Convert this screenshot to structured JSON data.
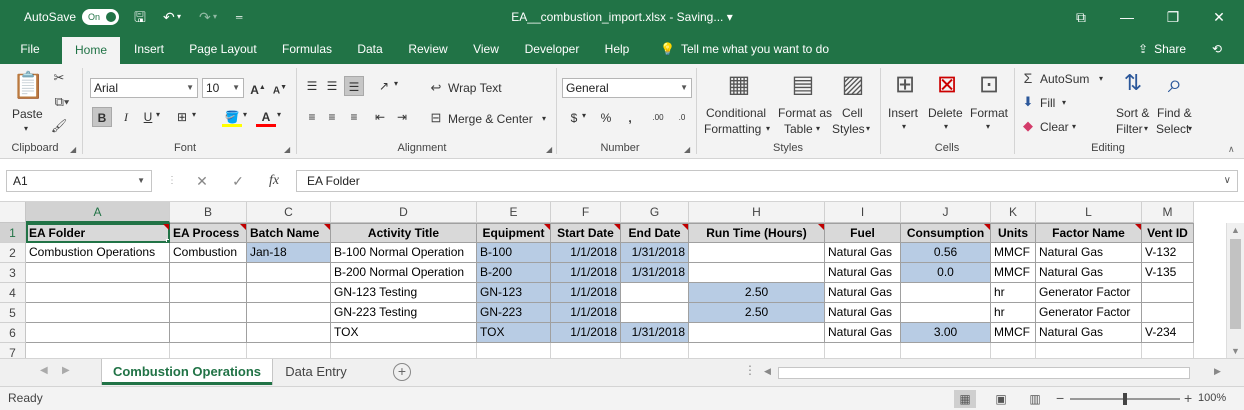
{
  "titlebar": {
    "autosave_label": "AutoSave",
    "autosave_state": "On",
    "title": "EA__combustion_import.xlsx  -  Saving...  ▾",
    "minimize": "—",
    "restore": "❐",
    "close": "✕",
    "ribbon_options": "⧉"
  },
  "tabs": [
    {
      "label": "File"
    },
    {
      "label": "Home"
    },
    {
      "label": "Insert"
    },
    {
      "label": "Page Layout"
    },
    {
      "label": "Formulas"
    },
    {
      "label": "Data"
    },
    {
      "label": "Review"
    },
    {
      "label": "View"
    },
    {
      "label": "Developer"
    },
    {
      "label": "Help"
    }
  ],
  "tell_me": "Tell me what you want to do",
  "share": "Share",
  "ribbon": {
    "clipboard": {
      "paste": "Paste",
      "label": "Clipboard"
    },
    "font": {
      "name": "Arial",
      "size": "10",
      "label": "Font"
    },
    "alignment": {
      "wrap": "Wrap Text",
      "merge": "Merge & Center",
      "label": "Alignment"
    },
    "number": {
      "format": "General",
      "label": "Number"
    },
    "styles": {
      "conditional_1": "Conditional",
      "conditional_2": "Formatting",
      "format_table_1": "Format as",
      "format_table_2": "Table",
      "cell_styles_1": "Cell",
      "cell_styles_2": "Styles",
      "label": "Styles"
    },
    "cells": {
      "insert": "Insert",
      "delete": "Delete",
      "format": "Format",
      "label": "Cells"
    },
    "editing": {
      "autosum": "AutoSum",
      "fill": "Fill",
      "clear": "Clear",
      "sort_1": "Sort &",
      "sort_2": "Filter",
      "find_1": "Find &",
      "find_2": "Select",
      "label": "Editing"
    }
  },
  "formula_bar": {
    "name_box": "A1",
    "fx": "fx",
    "value": "EA Folder"
  },
  "columns": [
    "A",
    "B",
    "C",
    "D",
    "E",
    "F",
    "G",
    "H",
    "I",
    "J",
    "K",
    "L",
    "M"
  ],
  "rows": [
    "1",
    "2",
    "3",
    "4",
    "5",
    "6",
    "7"
  ],
  "sheet": {
    "headers": [
      "EA Folder",
      "EA Process",
      "Batch Name",
      "Activity Title",
      "Equipment",
      "Start Date",
      "End Date",
      "Run Time (Hours)",
      "Fuel",
      "Consumption",
      "Units",
      "Factor Name",
      "Vent ID"
    ],
    "data": [
      [
        "Combustion Operations",
        "Combustion",
        "Jan-18",
        "B-100 Normal Operation",
        "B-100",
        "1/1/2018",
        "1/31/2018",
        "",
        "Natural Gas",
        "0.56",
        "MMCF",
        "Natural Gas",
        "V-132"
      ],
      [
        "",
        "",
        "",
        "B-200 Normal Operation",
        "B-200",
        "1/1/2018",
        "1/31/2018",
        "",
        "Natural Gas",
        "0.0",
        "MMCF",
        "Natural Gas",
        "V-135"
      ],
      [
        "",
        "",
        "",
        "GN-123 Testing",
        "GN-123",
        "1/1/2018",
        "",
        "2.50",
        "Natural Gas",
        "",
        "hr",
        "Generator Factor",
        ""
      ],
      [
        "",
        "",
        "",
        "GN-223 Testing",
        "GN-223",
        "1/1/2018",
        "",
        "2.50",
        "Natural Gas",
        "",
        "hr",
        "Generator Factor",
        ""
      ],
      [
        "",
        "",
        "",
        "TOX",
        "TOX",
        "1/1/2018",
        "1/31/2018",
        "",
        "Natural Gas",
        "3.00",
        "MMCF",
        "Natural Gas",
        "V-234"
      ]
    ]
  },
  "sheet_tabs": [
    {
      "label": "Combustion Operations",
      "active": true
    },
    {
      "label": "Data Entry",
      "active": false
    }
  ],
  "status": {
    "text": "Ready",
    "zoom": "100%"
  },
  "colors": {
    "excel_green": "#217346",
    "input_blue": "#b8cce4",
    "header_gray": "#d9d9d9",
    "comment_red": "#c00000"
  }
}
